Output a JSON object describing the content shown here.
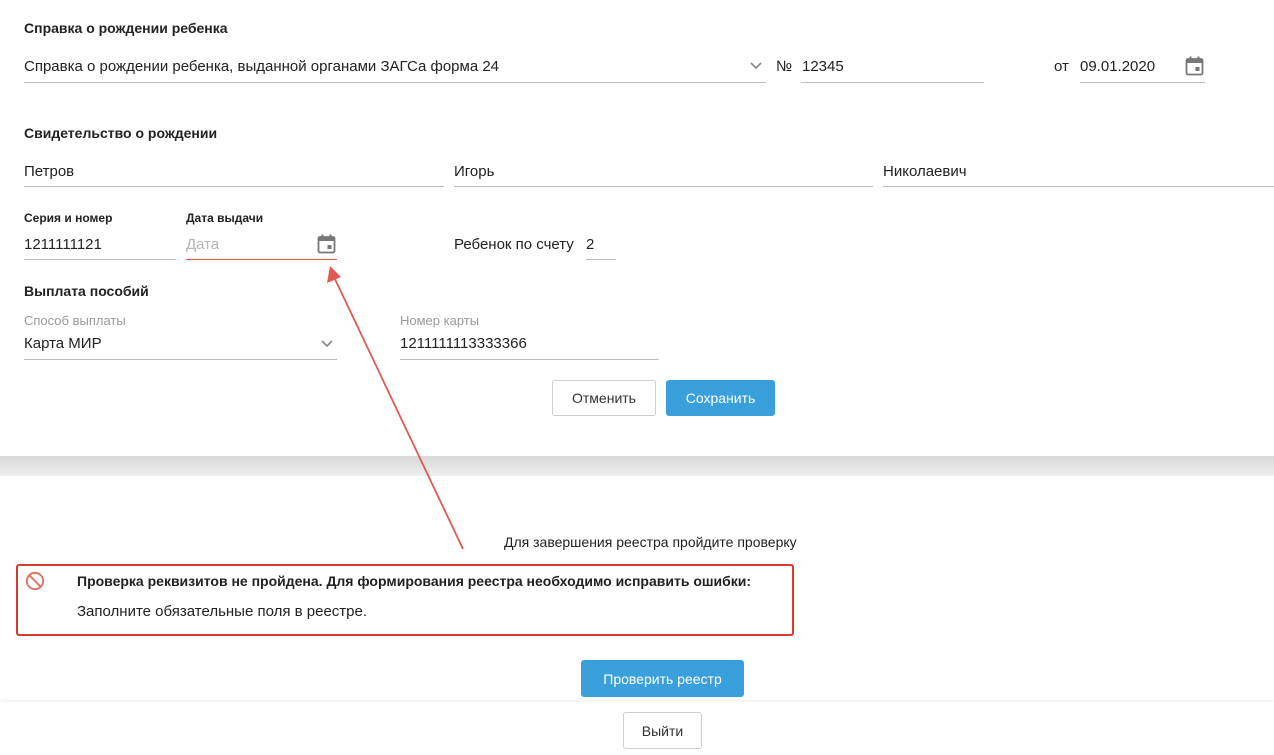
{
  "birth_cert_ref": {
    "title": "Справка о рождении ребенка",
    "doc_type": "Справка о рождении ребенка, выданной органами ЗАГСа форма 24",
    "number_label": "№",
    "number": "12345",
    "date_label": "от",
    "date": "09.01.2020"
  },
  "birth_certificate": {
    "title": "Свидетельство о рождении",
    "last_name": "Петров",
    "first_name": "Игорь",
    "patronymic": "Николаевич",
    "series_label": "Серия и номер",
    "series": "1211111121",
    "issue_date_label": "Дата выдачи",
    "issue_date_placeholder": "Дата",
    "child_order_label": "Ребенок по счету",
    "child_order": "2"
  },
  "payment": {
    "title": "Выплата пособий",
    "method_label": "Способ выплаты",
    "method": "Карта МИР",
    "card_label": "Номер карты",
    "card": "1211111113333366"
  },
  "actions": {
    "cancel": "Отменить",
    "save": "Сохранить"
  },
  "check": {
    "hint": "Для завершения реестра пройдите проверку",
    "error_title": "Проверка реквизитов не пройдена. Для формирования реестра необходимо исправить ошибки:",
    "error_detail": "Заполните обязательные поля в реестре.",
    "verify_button": "Проверить реестр"
  },
  "footer": {
    "exit": "Выйти"
  },
  "colors": {
    "accent": "#3aa0dc",
    "error": "#d63a33",
    "annotation": "#e05a50"
  }
}
